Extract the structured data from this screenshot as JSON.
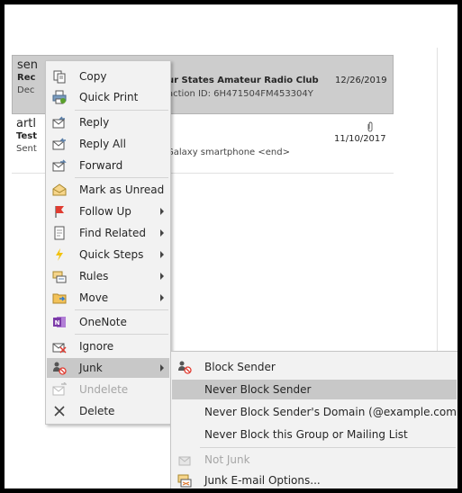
{
  "messages": [
    {
      "sender": "sen",
      "subject": "Rec",
      "preview": "Dec",
      "subject_tail": "ur States Amateur Radio Club",
      "preview_tail": "action ID: 6H471504FM453304Y",
      "date": "12/26/2019"
    },
    {
      "sender": "artl",
      "subject": "Test",
      "preview": "Sent",
      "subject_tail": "",
      "preview_tail": "Galaxy smartphone <end>",
      "date": "11/10/2017"
    }
  ],
  "context_menu": {
    "items": [
      {
        "label": "Copy",
        "icon": "copy-icon"
      },
      {
        "label": "Quick Print",
        "icon": "print-icon"
      },
      {
        "label": "Reply",
        "icon": "reply-icon"
      },
      {
        "label": "Reply All",
        "icon": "reply-all-icon"
      },
      {
        "label": "Forward",
        "icon": "forward-icon"
      },
      {
        "label": "Mark as Unread",
        "icon": "mark-unread-icon"
      },
      {
        "label": "Follow Up",
        "icon": "flag-icon"
      },
      {
        "label": "Find Related",
        "icon": "find-related-icon"
      },
      {
        "label": "Quick Steps",
        "icon": "lightning-icon"
      },
      {
        "label": "Rules",
        "icon": "rules-icon"
      },
      {
        "label": "Move",
        "icon": "folder-icon"
      },
      {
        "label": "OneNote",
        "icon": "onenote-icon"
      },
      {
        "label": "Ignore",
        "icon": "ignore-icon"
      },
      {
        "label": "Junk",
        "icon": "junk-icon"
      },
      {
        "label": "Undelete",
        "icon": "undelete-icon"
      },
      {
        "label": "Delete",
        "icon": "delete-icon"
      }
    ]
  },
  "junk_submenu": {
    "items": [
      {
        "label": "Block Sender"
      },
      {
        "label": "Never Block Sender"
      },
      {
        "label": "Never Block Sender's Domain (@example.com)"
      },
      {
        "label": "Never Block this Group or Mailing List"
      },
      {
        "label": "Not Junk"
      },
      {
        "label": "Junk E-mail Options..."
      }
    ]
  },
  "colors": {
    "highlight": "#c8c8c8",
    "menu_bg": "#f2f2f2",
    "selected_row": "#cdcdcd",
    "flag_red": "#e03c31",
    "onenote_purple": "#7b3aa8"
  }
}
